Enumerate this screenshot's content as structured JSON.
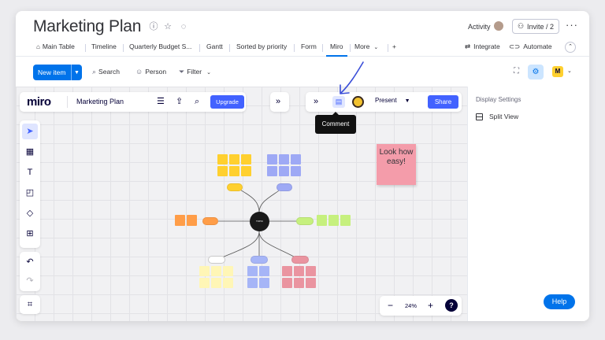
{
  "header": {
    "title": "Marketing Plan",
    "activity_label": "Activity",
    "invite_label": "Invite / 2",
    "more_dots": "···"
  },
  "tabs": [
    {
      "label": "Main Table"
    },
    {
      "label": "Timeline"
    },
    {
      "label": "Quarterly Budget S..."
    },
    {
      "label": "Gantt"
    },
    {
      "label": "Sorted by priority"
    },
    {
      "label": "Form"
    },
    {
      "label": "Miro"
    },
    {
      "label": "More"
    },
    {
      "label": "+"
    }
  ],
  "integrations": {
    "integrate_label": "Integrate",
    "automate_label": "Automate"
  },
  "toolbar": {
    "new_item_label": "New item",
    "search_label": "Search",
    "person_label": "Person",
    "filter_label": "Filter"
  },
  "miro": {
    "logo": "miro",
    "board_name": "Marketing Plan",
    "upgrade_label": "Upgrade",
    "present_label": "Present",
    "share_label": "Share",
    "tooltip": "Comment",
    "zoom": "24%",
    "help_glyph": "?",
    "center_label": "TOPIC",
    "note_text": "Look how easy!"
  },
  "panel": {
    "title": "Display Settings",
    "split_view_label": "Split View",
    "help_label": "Help"
  },
  "colors": {
    "monday_blue": "#0073ea",
    "miro_blue": "#4262ff",
    "yellow": "#ffd02f",
    "lavender": "#9ea9f5",
    "orange": "#ff9d48",
    "green": "#c6f07e",
    "pale_yellow": "#fff6b6",
    "periwinkle": "#a6b5f7",
    "red": "#ea94a0",
    "pink_note": "#f49caa"
  }
}
